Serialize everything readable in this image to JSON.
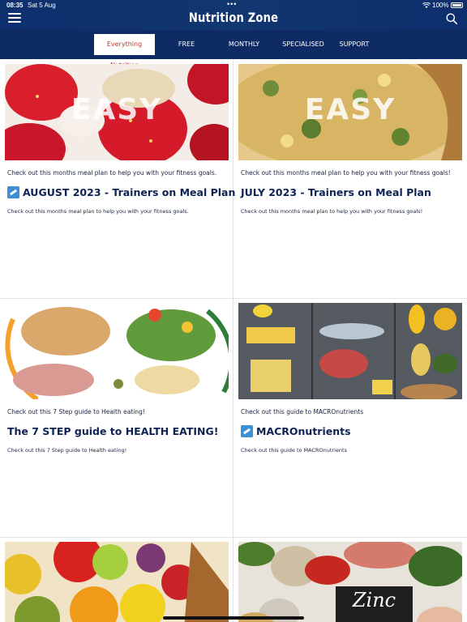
{
  "status_bar": {
    "time": "08:35",
    "date": "Sat 5 Aug",
    "dots": "•••",
    "battery": "100%"
  },
  "header": {
    "title": "Nutrition Zone",
    "menu_icon": "hamburger-menu-icon",
    "search_icon": "search-icon"
  },
  "nav": {
    "items": [
      {
        "label": "Everything Nutrition",
        "active": true
      },
      {
        "label": "FREE DOWNLOADS",
        "active": false
      },
      {
        "label": "MONTHLY PLANS",
        "active": false
      },
      {
        "label": "SPECIALISED PLANS",
        "active": false
      },
      {
        "label": "SUPPORT",
        "active": false
      }
    ]
  },
  "cards": [
    {
      "image_text": "EASY",
      "lead": "Check out this months meal plan to help you with your fitness goals.",
      "title": "AUGUST 2023 - Trainers on Meal Plan",
      "has_badge": true,
      "description": "Check out this months meal plan to help you with your fitness goals."
    },
    {
      "image_text": "EASY",
      "lead": "Check out this months meal plan to help you with your fitness goals!",
      "title": "JULY 2023 - Trainers on Meal Plan",
      "has_badge": false,
      "description": "Check out this months meal plan to help you with your fitness goals!"
    },
    {
      "image_text": "",
      "lead": "Check out this 7 Step guide to Health eating!",
      "title": "The 7 STEP guide to HEALTH EATING!",
      "has_badge": false,
      "description": "Check out this 7 Step guide to Health eating!"
    },
    {
      "image_text": "",
      "lead": "Check out this guide to MACROnutrients",
      "title": "MACROnutrients",
      "has_badge": true,
      "description": "Check out this guide to MACROnutrients"
    },
    {
      "image_text": "",
      "lead": "",
      "title": "",
      "has_badge": false,
      "description": ""
    },
    {
      "image_text": "Zinc",
      "lead": "",
      "title": "",
      "has_badge": false,
      "description": ""
    }
  ],
  "colors": {
    "header_bg": "#0d2f6e",
    "nav_bg": "#0e2b64",
    "active_tab_text": "#c0392b",
    "title_text": "#0e2354"
  }
}
